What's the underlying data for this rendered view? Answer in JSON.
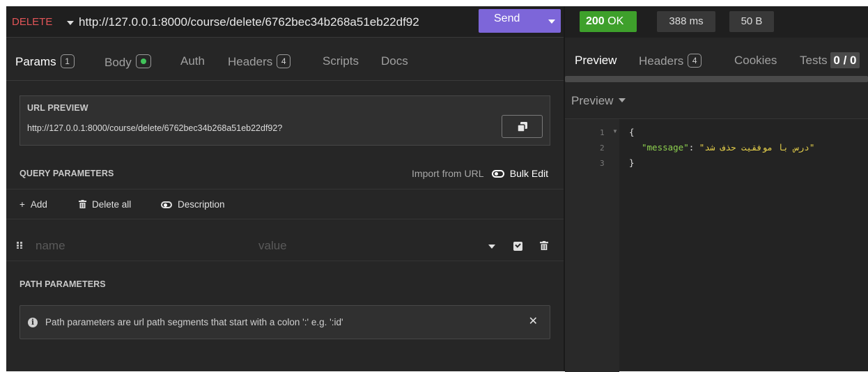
{
  "request": {
    "method": "DELETE",
    "url": "http://127.0.0.1:8000/course/delete/6762bec34b268a51eb22df92",
    "send_label": "Send"
  },
  "tabs": [
    {
      "label": "Params",
      "badge": "1",
      "active": true
    },
    {
      "label": "Body",
      "badge": "dot"
    },
    {
      "label": "Auth"
    },
    {
      "label": "Headers",
      "badge": "4"
    },
    {
      "label": "Scripts"
    },
    {
      "label": "Docs"
    }
  ],
  "url_preview": {
    "title": "URL PREVIEW",
    "value": "http://127.0.0.1:8000/course/delete/6762bec34b268a51eb22df92?",
    "copy_icon": "copy-icon"
  },
  "query_params": {
    "title": "QUERY PARAMETERS",
    "import_label": "Import from URL",
    "bulk_edit_label": "Bulk Edit",
    "add_label": "Add",
    "delete_all_label": "Delete all",
    "description_label": "Description",
    "row": {
      "name_placeholder": "name",
      "value_placeholder": "value",
      "enabled": true
    }
  },
  "path_params": {
    "title": "PATH PARAMETERS",
    "info": "Path parameters are url path segments that start with a colon ':' e.g. ':id'"
  },
  "response": {
    "status": "200",
    "status_text": "OK",
    "time": "388 ms",
    "size": "50 B",
    "status_color": "#3ea02b",
    "tabs": {
      "preview": "Preview",
      "headers": "Headers",
      "headers_count": "4",
      "cookies": "Cookies",
      "tests": "Tests",
      "tests_count": "0 / 0"
    },
    "preview_mode": "Preview",
    "body": {
      "line_numbers": [
        "1",
        "2",
        "3"
      ],
      "open_brace": "{",
      "key": "\"message\"",
      "colon": ": ",
      "value": "\"درس با موفقیت حذف شد\"",
      "close_brace": "}"
    }
  }
}
